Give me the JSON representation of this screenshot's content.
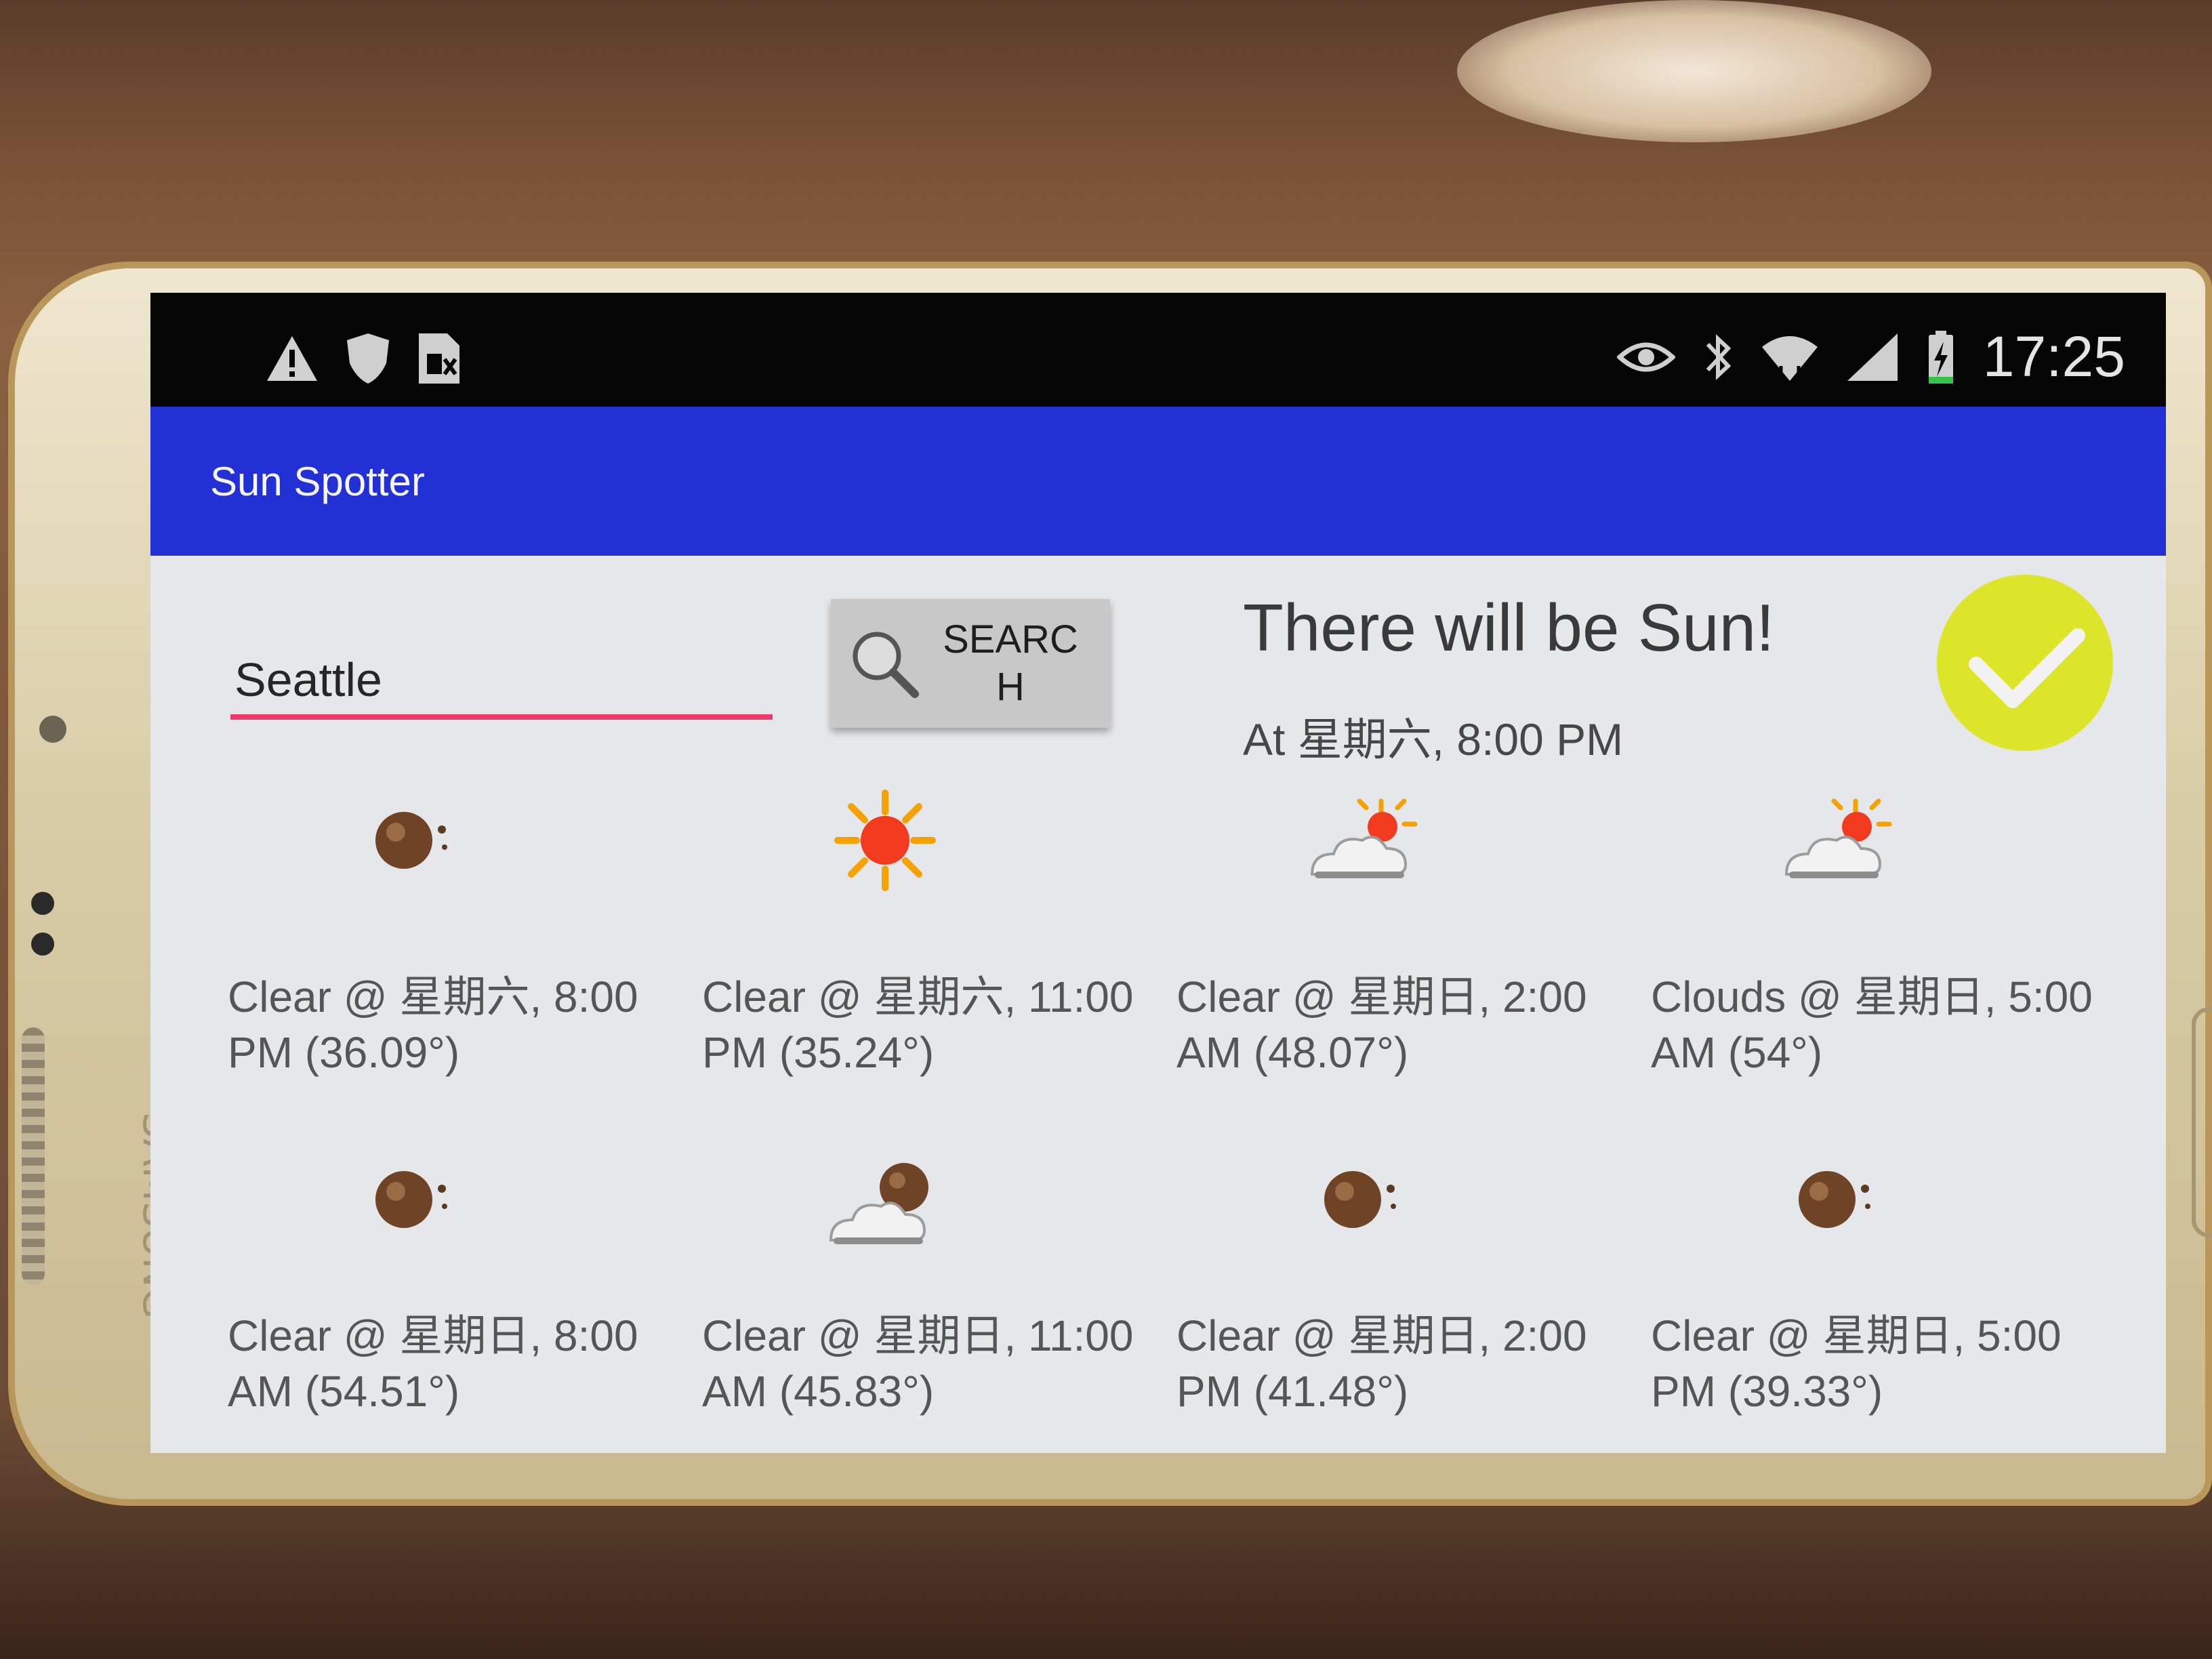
{
  "status_bar": {
    "time": "17:25",
    "left_icons": [
      "warning-icon",
      "shield-icon",
      "sim-card-icon"
    ],
    "right_icons": [
      "eye-icon",
      "bluetooth-icon",
      "wifi-icon",
      "signal-icon",
      "battery-charging-icon"
    ]
  },
  "app": {
    "title": "Sun Spotter",
    "accent_color": "#2230d6",
    "input_underline_color": "#ee3a68"
  },
  "search": {
    "city_value": "Seattle",
    "button_label": "SEARCH"
  },
  "verdict": {
    "headline": "There will be Sun!",
    "time": "At 星期六, 8:00 PM",
    "badge_icon": "checkmark-icon",
    "badge_color": "#dde52a"
  },
  "forecast": [
    {
      "icon": "clear-night-icon",
      "text": "Clear @ 星期六, 8:00 PM (36.09°)"
    },
    {
      "icon": "sun-icon",
      "text": "Clear @ 星期六, 11:00 PM (35.24°)"
    },
    {
      "icon": "partly-cloudy-day-icon",
      "text": "Clear @ 星期日, 2:00 AM (48.07°)"
    },
    {
      "icon": "partly-cloudy-day-icon",
      "text": "Clouds @ 星期日, 5:00 AM (54°)"
    },
    {
      "icon": "clear-night-icon",
      "text": "Clear @ 星期日, 8:00 AM (54.51°)"
    },
    {
      "icon": "partly-cloudy-night-icon",
      "text": "Clear @ 星期日, 11:00 AM (45.83°)"
    },
    {
      "icon": "clear-night-icon",
      "text": "Clear @ 星期日, 2:00 PM (41.48°)"
    },
    {
      "icon": "clear-night-icon",
      "text": "Clear @ 星期日, 5:00 PM (39.33°)"
    }
  ],
  "device": {
    "brand": "SAMSUNG"
  }
}
